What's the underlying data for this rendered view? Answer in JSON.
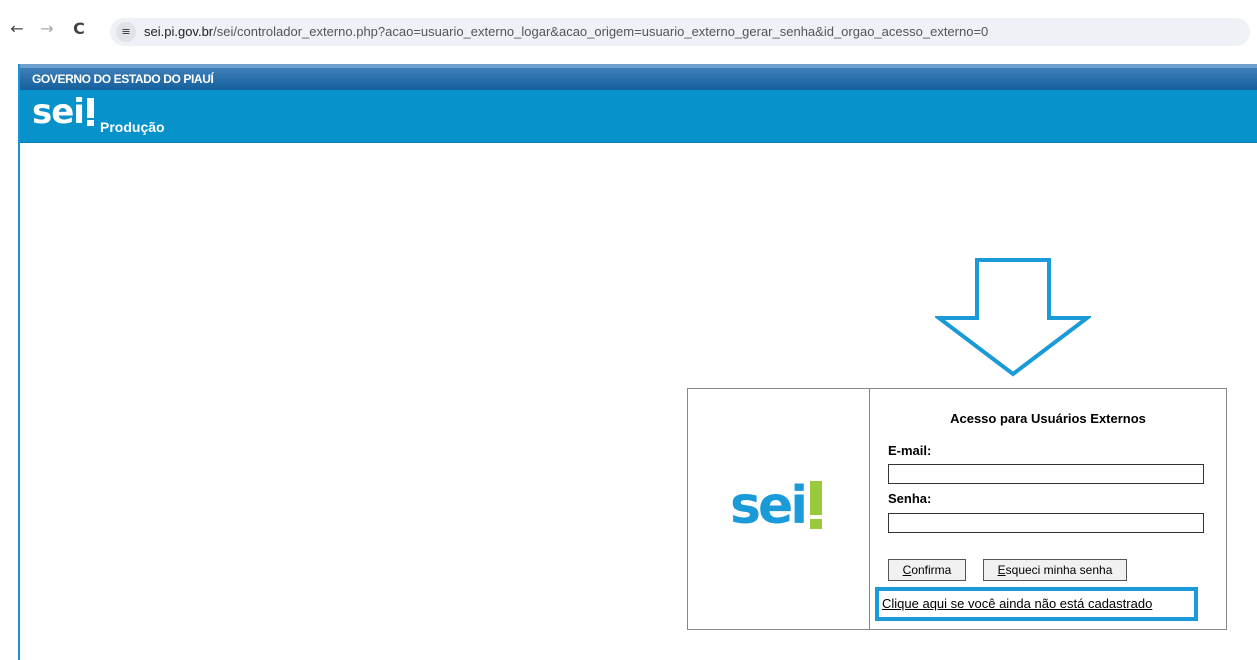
{
  "browser": {
    "back_glyph": "←",
    "forward_glyph": "→",
    "reload_glyph": "C",
    "site_info_icon": "tune-icon",
    "url_domain": "sei.pi.gov.br",
    "url_path": "/sei/controlador_externo.php?acao=usuario_externo_logar&acao_origem=usuario_externo_gerar_senha&id_orgao_acesso_externo=0"
  },
  "header": {
    "government": "GOVERNO DO ESTADO DO PIAUÍ",
    "logo_text": "sei",
    "environment": "Produção"
  },
  "login": {
    "logo_text": "sei",
    "title": "Acesso para Usuários Externos",
    "email_label": "E-mail:",
    "email_value": "",
    "password_label": "Senha:",
    "password_value": "",
    "confirm_accesskey": "C",
    "confirm_rest": "onfirma",
    "forgot_accesskey": "E",
    "forgot_rest": "squeci minha senha",
    "register_link": "Clique aqui se você ainda não está cadastrado"
  },
  "colors": {
    "gov_bar": "#14609e",
    "sei_bar": "#0792cc",
    "logo_blue": "#1a9ad8",
    "logo_green": "#9ac93c",
    "highlight": "#1a9ad8"
  }
}
